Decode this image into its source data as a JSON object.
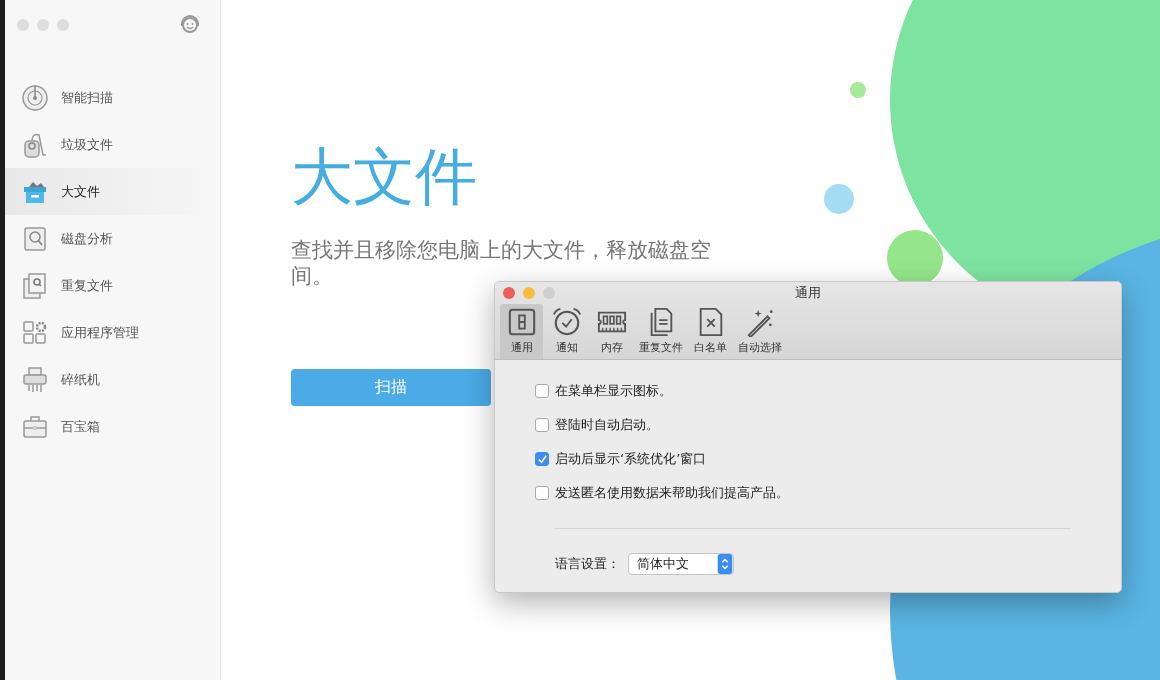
{
  "sidebar": {
    "items": [
      {
        "label": "智能扫描",
        "kind": "radar",
        "selected": false
      },
      {
        "label": "垃圾文件",
        "kind": "vacuum",
        "selected": false
      },
      {
        "label": "大文件",
        "kind": "box",
        "selected": true
      },
      {
        "label": "磁盘分析",
        "kind": "disk",
        "selected": false
      },
      {
        "label": "重复文件",
        "kind": "duplicate",
        "selected": false
      },
      {
        "label": "应用程序管理",
        "kind": "apps",
        "selected": false
      },
      {
        "label": "碎纸机",
        "kind": "shredder",
        "selected": false
      },
      {
        "label": "百宝箱",
        "kind": "toolbox",
        "selected": false
      }
    ]
  },
  "main": {
    "title": "大文件",
    "description": "查找并且移除您电脑上的大文件，释放磁盘空间。",
    "scan_button": "扫描"
  },
  "dialog": {
    "title": "通用",
    "tabs": [
      {
        "label": "通用",
        "kind": "general",
        "selected": true
      },
      {
        "label": "通知",
        "kind": "notification",
        "selected": false
      },
      {
        "label": "内存",
        "kind": "memory",
        "selected": false
      },
      {
        "label": "重复文件",
        "kind": "duplicate",
        "selected": false
      },
      {
        "label": "白名单",
        "kind": "whitelist",
        "selected": false
      },
      {
        "label": "自动选择",
        "kind": "autoselect",
        "selected": false
      }
    ],
    "options": [
      {
        "label": "在菜单栏显示图标。",
        "checked": false
      },
      {
        "label": "登陆时自动启动。",
        "checked": false
      },
      {
        "label": "启动后显示‘系统优化’窗口",
        "checked": true
      },
      {
        "label": "发送匿名使用数据来帮助我们提高产品。",
        "checked": false
      }
    ],
    "language": {
      "label": "语言设置：",
      "value": "简体中文"
    }
  }
}
